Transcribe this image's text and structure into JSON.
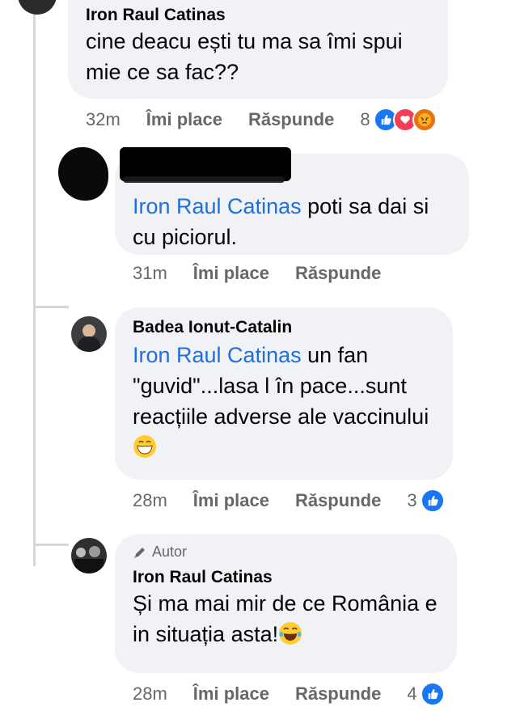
{
  "comments": [
    {
      "author": "Iron Raul Catinas",
      "text": "cine deacu ești tu ma sa îmi spui mie ce sa fac??",
      "time": "32m",
      "like_label": "Îmi place",
      "reply_label": "Răspunde",
      "reaction_count": "8",
      "reactions": [
        "like-icon",
        "love-icon",
        "angry-icon"
      ]
    },
    {
      "author": "",
      "mention": "Iron Raul Catinas",
      "text": " poti sa dai si cu piciorul.",
      "time": "31m",
      "like_label": "Îmi place",
      "reply_label": "Răspunde"
    },
    {
      "author": "Badea Ionut-Catalin",
      "mention": "Iron Raul Catinas",
      "text": " un fan \"guvid\"...lasa l în pace...sunt reacțiile adverse ale vaccinului",
      "emoji": "grinning-face-icon",
      "time": "28m",
      "like_label": "Îmi place",
      "reply_label": "Răspunde",
      "reaction_count": "3",
      "reactions": [
        "like-icon"
      ]
    },
    {
      "badge": "Autor",
      "author": "Iron Raul Catinas",
      "text": "Și ma mai mir de ce România e in situația asta!",
      "emoji": "tears-of-joy-icon",
      "time": "28m",
      "like_label": "Îmi place",
      "reply_label": "Răspunde",
      "reaction_count": "4",
      "reactions": [
        "like-icon"
      ]
    }
  ],
  "colors": {
    "bubble": "#f0f2f5",
    "mention": "#216fdb",
    "like": "#1877f2",
    "love": "#f33e58",
    "angry": "#e9710f"
  }
}
